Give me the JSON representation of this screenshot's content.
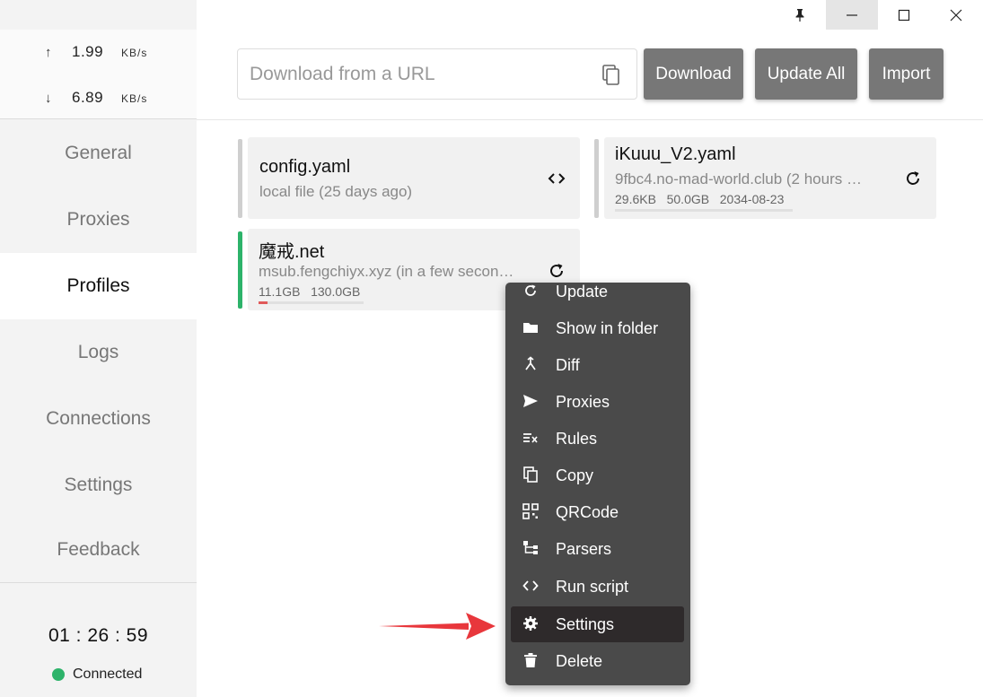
{
  "window": {
    "pin_icon": "pin-icon",
    "minimize_icon": "minimize-icon",
    "maximize_icon": "maximize-icon",
    "close_icon": "close-icon"
  },
  "sidebar": {
    "traffic": {
      "up_arrow": "↑",
      "up_value": "1.99",
      "up_unit": "KB/s",
      "down_arrow": "↓",
      "down_value": "6.89",
      "down_unit": "KB/s"
    },
    "items": [
      {
        "label": "General"
      },
      {
        "label": "Proxies"
      },
      {
        "label": "Profiles"
      },
      {
        "label": "Logs"
      },
      {
        "label": "Connections"
      },
      {
        "label": "Settings"
      },
      {
        "label": "Feedback"
      }
    ],
    "active_item": "Profiles",
    "timer": "01 : 26 : 59",
    "status": "Connected",
    "status_color": "#2db36a"
  },
  "toolbar": {
    "url_placeholder": "Download from a URL",
    "url_value": "",
    "download_label": "Download",
    "update_all_label": "Update All",
    "import_label": "Import"
  },
  "profiles": [
    {
      "title": "config.yaml",
      "subtitle": "local file (25 days ago)",
      "action_icon": "code-icon"
    },
    {
      "title": "iKuuu_V2.yaml",
      "subtitle": "9fbc4.no-mad-world.club (2 hours …",
      "used": "29.6KB",
      "total": "50.0GB",
      "expires": "2034-08-23",
      "usage_fraction": 0.0,
      "action_icon": "refresh-icon"
    },
    {
      "title": "魔戒.net",
      "subtitle": "msub.fengchiyx.xyz (in a few secon…",
      "used": "11.1GB",
      "total": "130.0GB",
      "usage_fraction": 0.085,
      "active": true,
      "active_color": "#2db36a",
      "action_icon": "refresh-icon"
    }
  ],
  "context_menu": {
    "items": [
      {
        "label": "Update",
        "icon": "refresh-icon"
      },
      {
        "label": "Show in folder",
        "icon": "folder-icon"
      },
      {
        "label": "Diff",
        "icon": "merge-icon"
      },
      {
        "label": "Proxies",
        "icon": "send-icon"
      },
      {
        "label": "Rules",
        "icon": "rules-icon"
      },
      {
        "label": "Copy",
        "icon": "copy-icon"
      },
      {
        "label": "QRCode",
        "icon": "qrcode-icon"
      },
      {
        "label": "Parsers",
        "icon": "tree-icon"
      },
      {
        "label": "Run script",
        "icon": "code-icon"
      },
      {
        "label": "Settings",
        "icon": "gear-icon"
      },
      {
        "label": "Delete",
        "icon": "trash-icon"
      }
    ],
    "highlighted": "Settings"
  },
  "colors": {
    "accent_arrow": "#e8373c",
    "button_bg": "#777777",
    "menu_bg": "#4a4a4a"
  }
}
